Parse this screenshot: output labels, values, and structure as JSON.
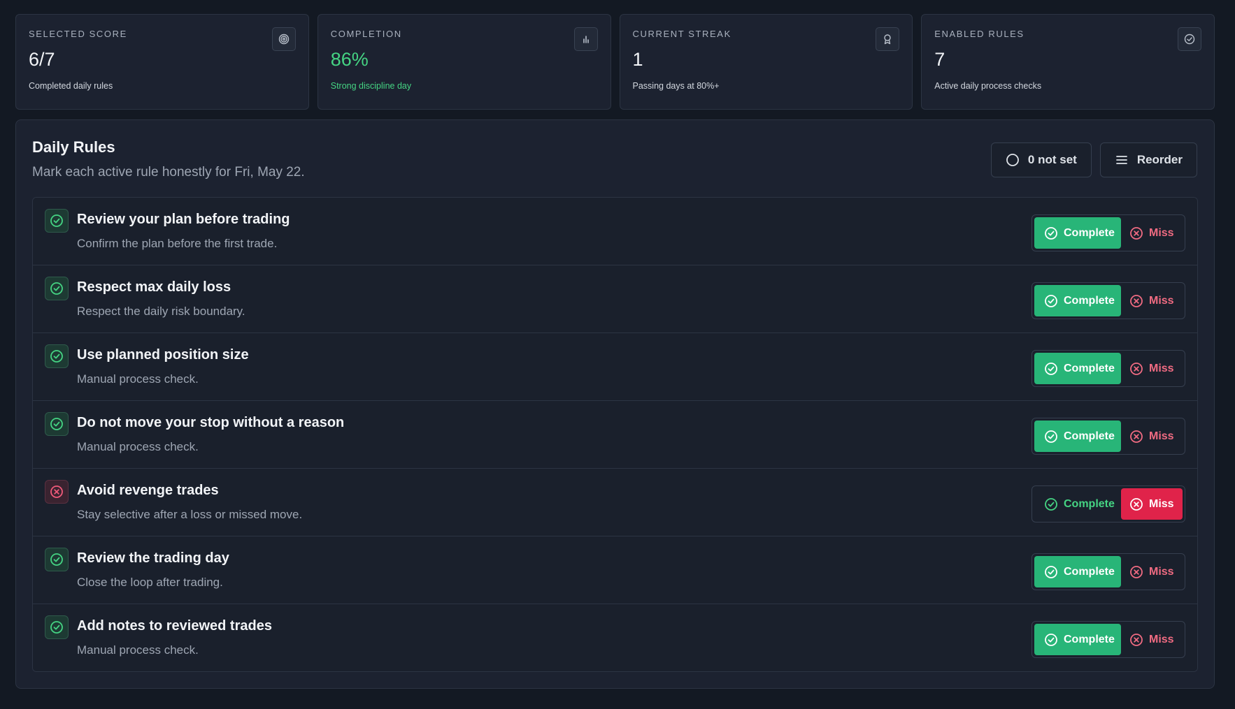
{
  "stats": [
    {
      "label": "SELECTED SCORE",
      "value": "6/7",
      "sub": "Completed daily rules",
      "icon": "target-icon",
      "accent": false
    },
    {
      "label": "COMPLETION",
      "value": "86%",
      "sub": "Strong discipline day",
      "icon": "bar-chart-icon",
      "accent": true
    },
    {
      "label": "CURRENT STREAK",
      "value": "1",
      "sub": "Passing days at 80%+",
      "icon": "award-icon",
      "accent": false
    },
    {
      "label": "ENABLED RULES",
      "value": "7",
      "sub": "Active daily process checks",
      "icon": "check-circle-icon",
      "accent": false
    }
  ],
  "panel": {
    "title": "Daily Rules",
    "subtitle": "Mark each active rule honestly for Fri, May 22.",
    "not_set_label": "0 not set",
    "reorder_label": "Reorder"
  },
  "buttons": {
    "complete": "Complete",
    "miss": "Miss"
  },
  "rules": [
    {
      "title": "Review your plan before trading",
      "desc": "Confirm the plan before the first trade.",
      "status": "complete"
    },
    {
      "title": "Respect max daily loss",
      "desc": "Respect the daily risk boundary.",
      "status": "complete"
    },
    {
      "title": "Use planned position size",
      "desc": "Manual process check.",
      "status": "complete"
    },
    {
      "title": "Do not move your stop without a reason",
      "desc": "Manual process check.",
      "status": "complete"
    },
    {
      "title": "Avoid revenge trades",
      "desc": "Stay selective after a loss or missed move.",
      "status": "miss"
    },
    {
      "title": "Review the trading day",
      "desc": "Close the loop after trading.",
      "status": "complete"
    },
    {
      "title": "Add notes to reviewed trades",
      "desc": "Manual process check.",
      "status": "complete"
    }
  ],
  "colors": {
    "green": "#45d483",
    "complete_bg": "#28b578",
    "miss_bg": "#e0234a",
    "card_bg": "#1c2230"
  }
}
